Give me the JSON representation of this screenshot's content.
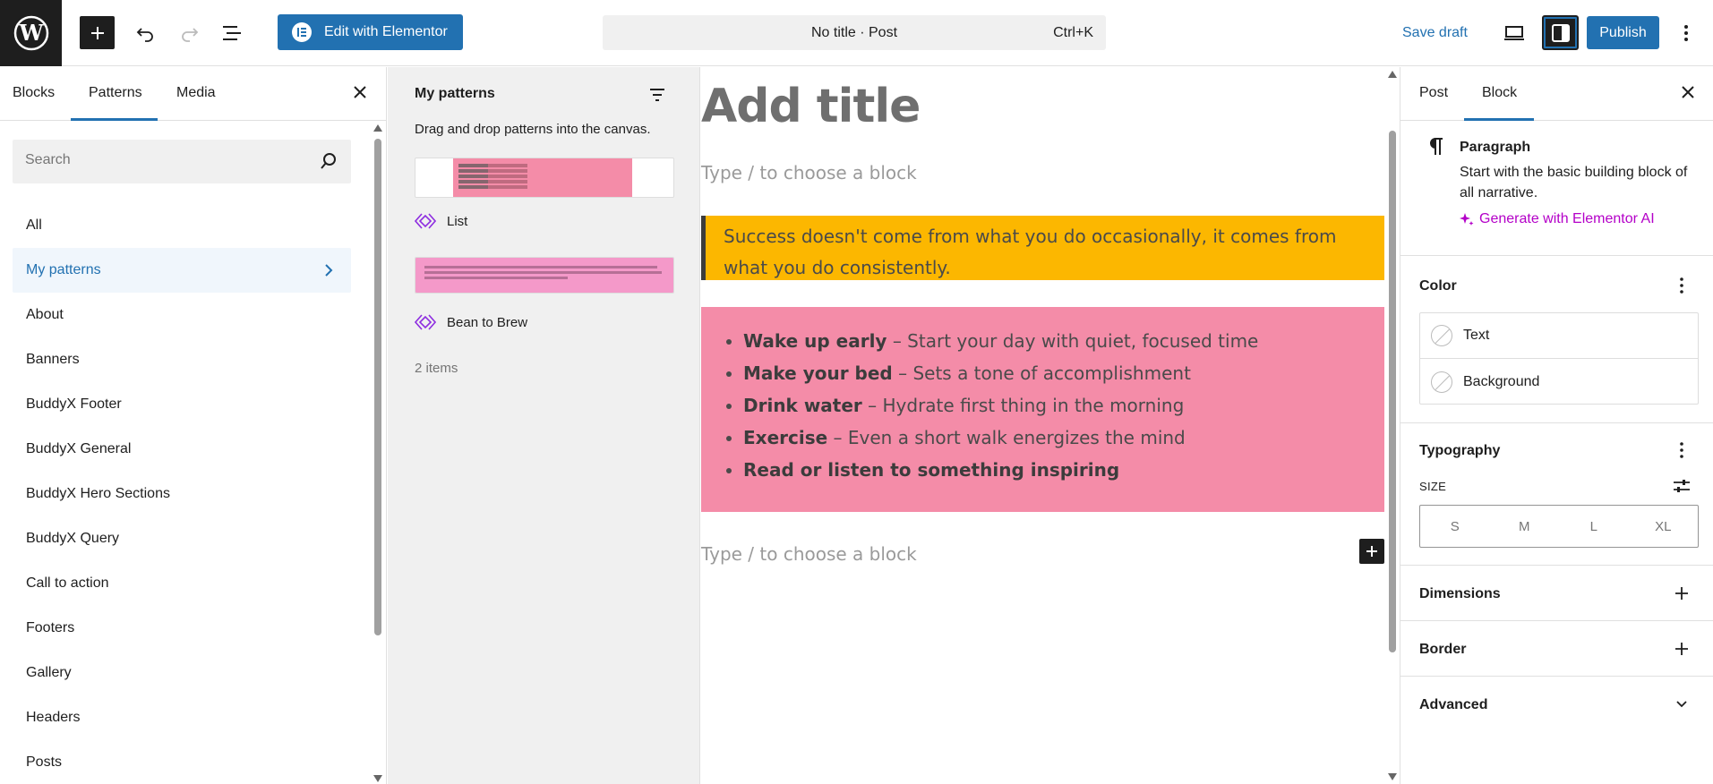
{
  "topbar": {
    "elementor_label": "Edit with Elementor",
    "doc_title": "No title · Post",
    "doc_shortcut": "Ctrl+K",
    "save_draft": "Save draft",
    "publish": "Publish"
  },
  "inserter": {
    "tabs": [
      "Blocks",
      "Patterns",
      "Media"
    ],
    "search_placeholder": "Search",
    "categories": [
      "All",
      "My patterns",
      "About",
      "Banners",
      "BuddyX Footer",
      "BuddyX General",
      "BuddyX Hero Sections",
      "BuddyX Query",
      "Call to action",
      "Footers",
      "Gallery",
      "Headers",
      "Posts"
    ]
  },
  "patterns": {
    "title": "My patterns",
    "description": "Drag and drop patterns into the canvas.",
    "items": [
      {
        "label": "List"
      },
      {
        "label": "Bean to Brew"
      }
    ],
    "count": "2 items"
  },
  "canvas": {
    "title_placeholder": "Add title",
    "block_placeholder": "Type / to choose a block",
    "quote": "Success doesn't come from what you do occasionally, it comes from what you do consistently.",
    "list": [
      {
        "bold": "Wake up early",
        "rest": " – Start your day with quiet, focused time"
      },
      {
        "bold": "Make your bed",
        "rest": " – Sets a tone of accomplishment"
      },
      {
        "bold": "Drink water",
        "rest": " – Hydrate first thing in the morning"
      },
      {
        "bold": "Exercise",
        "rest": " – Even a short walk energizes the mind"
      },
      {
        "bold": "Read or listen to something inspiring",
        "rest": ""
      }
    ]
  },
  "settings": {
    "tabs": [
      "Post",
      "Block"
    ],
    "block_name": "Paragraph",
    "block_desc": "Start with the basic building block of all narrative.",
    "ai_link": "Generate with Elementor AI",
    "color_head": "Color",
    "color_items": [
      "Text",
      "Background"
    ],
    "typography_head": "Typography",
    "size_label": "SIZE",
    "sizes": [
      "S",
      "M",
      "L",
      "XL"
    ],
    "dimensions_head": "Dimensions",
    "border_head": "Border",
    "advanced_head": "Advanced"
  },
  "colors": {
    "accent": "#2271b1",
    "quote_bg": "#fcb700",
    "list_bg": "#f48ca8",
    "ai": "#b400c8"
  }
}
